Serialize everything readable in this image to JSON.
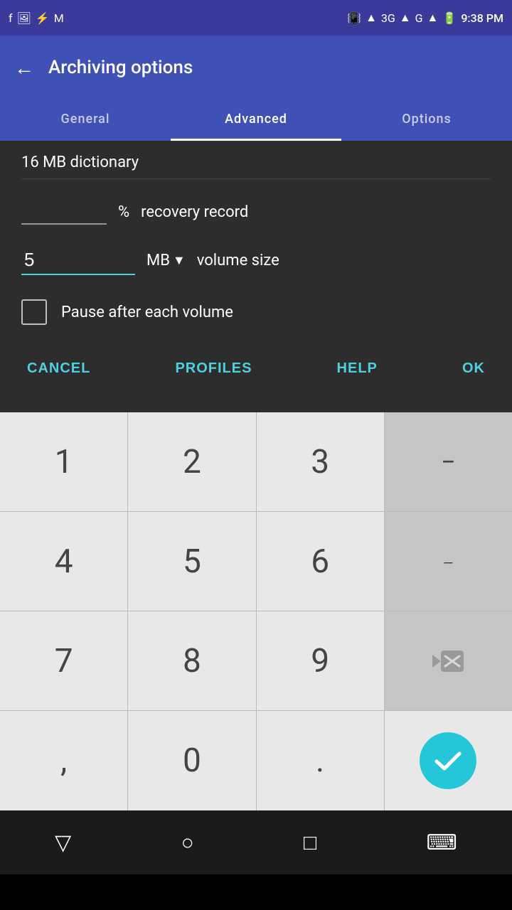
{
  "statusBar": {
    "time": "9:38 PM",
    "icons": [
      "fb",
      "image",
      "usb",
      "gmail",
      "vibrate",
      "wifi",
      "3g",
      "signal",
      "battery"
    ]
  },
  "appBar": {
    "title": "Archiving options",
    "backLabel": "←"
  },
  "tabs": [
    {
      "id": "general",
      "label": "General"
    },
    {
      "id": "advanced",
      "label": "Advanced",
      "active": true
    },
    {
      "id": "options",
      "label": "Options"
    }
  ],
  "content": {
    "partialText": "16 MB dictionary",
    "recoveryRecord": {
      "placeholder": "",
      "percentLabel": "%",
      "fieldLabel": "recovery record"
    },
    "volumeSize": {
      "value": "5",
      "unit": "MB",
      "label": "volume size"
    },
    "pauseCheckbox": {
      "checked": false,
      "label": "Pause after each volume"
    },
    "buttons": {
      "cancel": "CANCEL",
      "profiles": "PROFILES",
      "help": "HELP",
      "ok": "OK"
    }
  },
  "keyboard": {
    "rows": [
      [
        "1",
        "2",
        "3",
        "−"
      ],
      [
        "4",
        "5",
        "6",
        "⎵"
      ],
      [
        "7",
        "8",
        "9",
        "⌫"
      ],
      [
        ",",
        "0",
        ".",
        "✓"
      ]
    ]
  },
  "navBar": {
    "back": "▽",
    "home": "○",
    "recent": "□",
    "keyboard": "⌨"
  }
}
